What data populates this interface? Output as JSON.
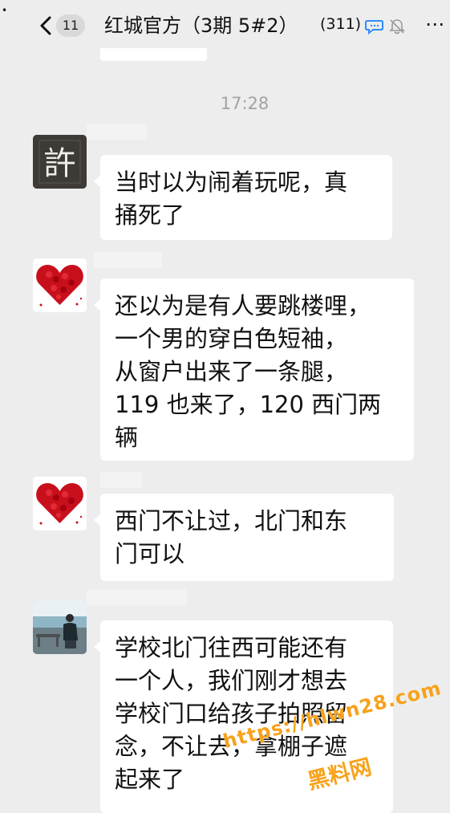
{
  "header": {
    "dot": "•",
    "unread_count": "11",
    "title": "红城官方（3期 5#2）",
    "member_count": "(311)",
    "more": "⋯"
  },
  "timestamp": "17:28",
  "messages": [
    {
      "avatar": "calligraphy-avatar",
      "avatar_text": "許",
      "text": "当时以为闹着玩呢，真\n捅死了"
    },
    {
      "avatar": "red-heart-roses-avatar",
      "text": "还以为是有人要跳楼哩，\n一个男的穿白色短袖，\n从窗户出来了一条腿，\n119 也来了，120 西门两\n辆"
    },
    {
      "avatar": "red-heart-roses-avatar",
      "text": "西门不让过，北门和东\n门可以"
    },
    {
      "avatar": "person-photo-avatar",
      "text": "学校北门往西可能还有\n一个人，我们刚才想去\n学校门口给孩子拍照留\n念，不让去，拿棚子遮\n起来了"
    }
  ],
  "watermark": {
    "url": "https://hlwn28.com",
    "text": "黑料网"
  },
  "colors": {
    "background": "#ededed",
    "bubble": "#ffffff",
    "watermark": "#f7a21b",
    "timestamp": "#a3a3a3"
  }
}
